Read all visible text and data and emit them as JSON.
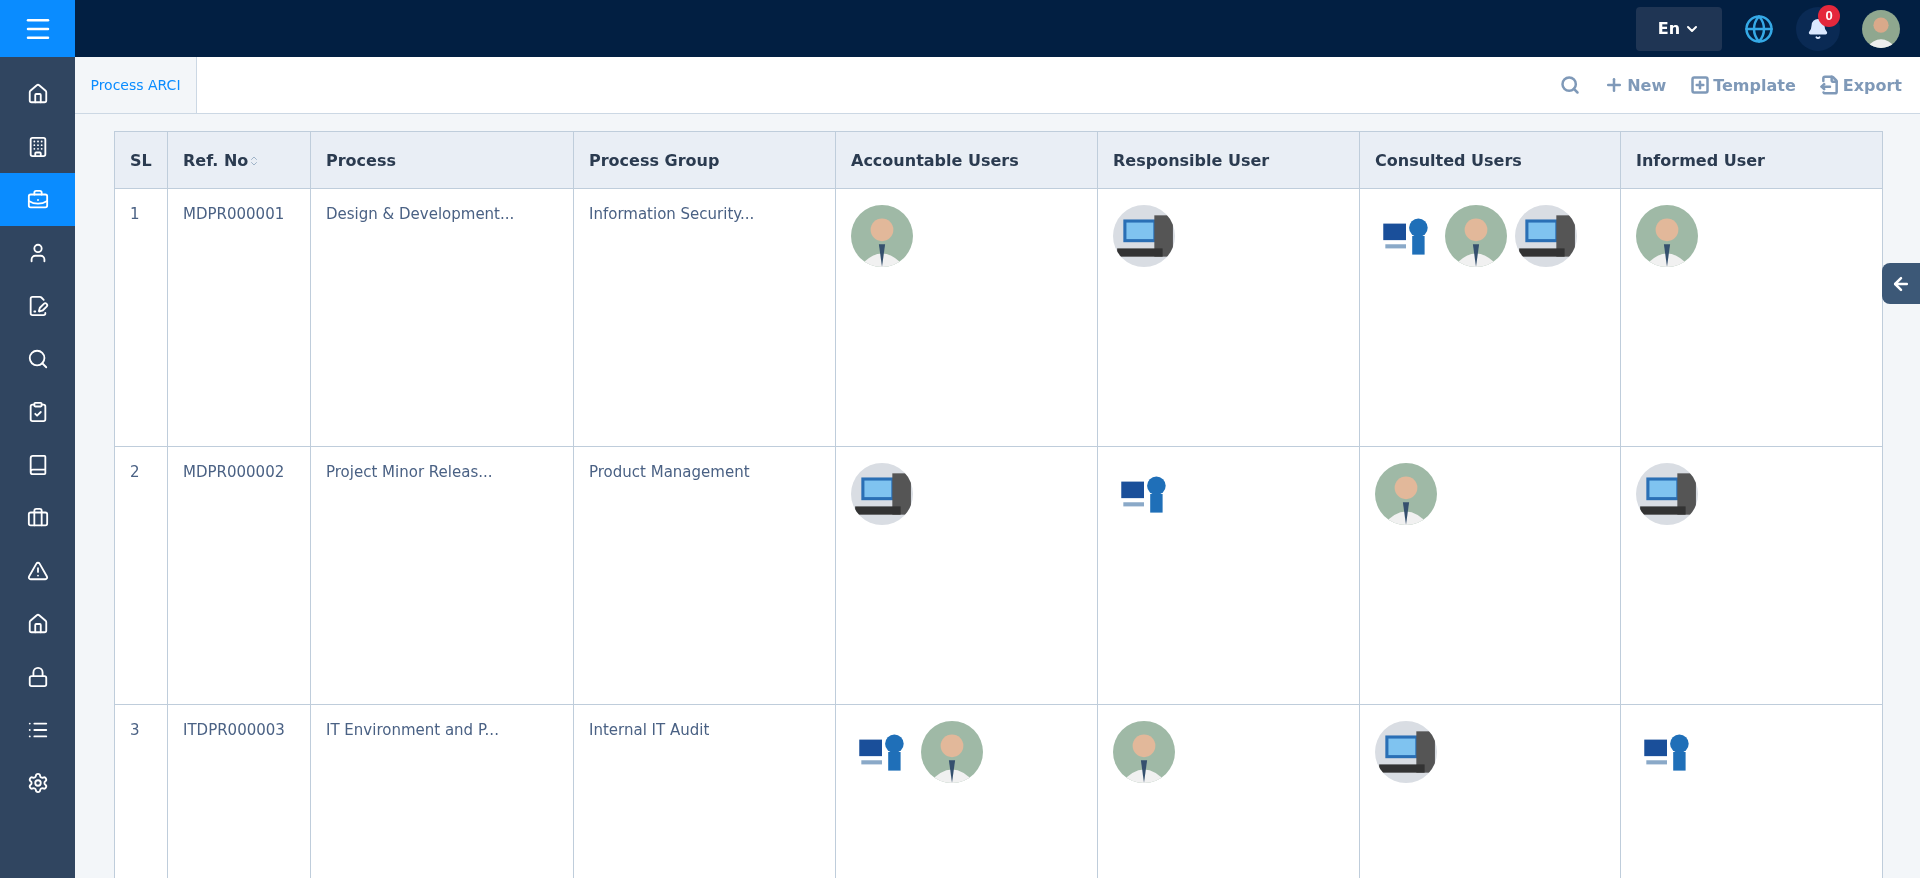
{
  "topbar": {
    "language": "En",
    "notifications": "0"
  },
  "sidebar": {
    "items": [
      {
        "selected": false
      },
      {
        "selected": false
      },
      {
        "selected": true
      },
      {
        "selected": false
      },
      {
        "selected": false
      },
      {
        "selected": false
      },
      {
        "selected": false
      },
      {
        "selected": false
      },
      {
        "selected": false
      },
      {
        "selected": false
      },
      {
        "selected": false
      },
      {
        "selected": false
      },
      {
        "selected": false
      },
      {
        "selected": false
      }
    ]
  },
  "tabs": [
    {
      "label": "Process ARCI",
      "selected": true
    }
  ],
  "toolbar": {
    "actions": [
      {
        "kind": "new",
        "label": "New"
      },
      {
        "kind": "template",
        "label": "Template"
      },
      {
        "kind": "export",
        "label": "Export"
      }
    ]
  },
  "table": {
    "columns": [
      "SL",
      "Ref. No",
      "Process",
      "Process Group",
      "Accountable Users",
      "Responsible User",
      "Consulted Users",
      "Informed User"
    ],
    "rows": [
      {
        "sl": "1",
        "ref": "MDPR000001",
        "process": "Design & Development...",
        "group": "Information Security..."
      },
      {
        "sl": "2",
        "ref": "MDPR000002",
        "process": "Project Minor Releas...",
        "group": "Product Management"
      },
      {
        "sl": "3",
        "ref": "ITDPR000003",
        "process": "IT Environment and P...",
        "group": "Internal IT Audit"
      }
    ]
  }
}
